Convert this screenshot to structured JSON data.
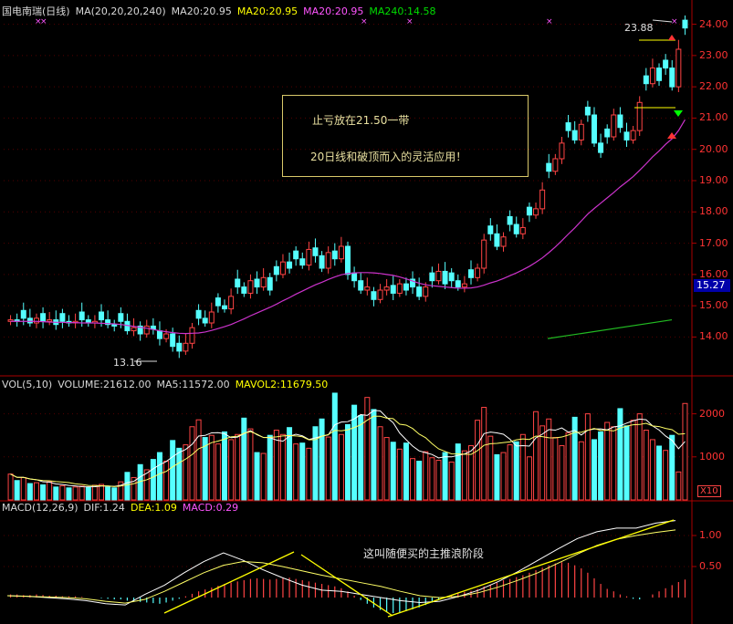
{
  "header": {
    "stock": "国电南瑞(日线)",
    "ma_params": "MA(20,20,20,240)",
    "ma20a": "MA20:20.95",
    "ma20b": "MA20:20.95",
    "ma20c": "MA20:20.95",
    "ma240": "MA240:14.58"
  },
  "vol_header": {
    "params": "VOL(5,10)",
    "volume": "VOLUME:21612.00",
    "ma5": "MA5:11572.00",
    "mavol2": "MAVOL2:11679.50"
  },
  "macd_header": {
    "params": "MACD(12,26,9)",
    "dif": "DIF:1.24",
    "dea": "DEA:1.09",
    "macd": "MACD:0.29"
  },
  "annotations": {
    "note_line1": "止亏放在21.50一带",
    "note_line2": "20日线和破顶而入的灵活应用！",
    "macd_note": "这叫随便买的主推浪阶段",
    "low_label": "13.16",
    "high_label": "23.88",
    "last_price": "15.27",
    "vol_unit": "X10"
  },
  "colors": {
    "up": "#ff4444",
    "down": "#55ffff",
    "ma20": "#cc33cc",
    "ma240": "#22bb22",
    "vol_ma5": "#ffffff",
    "vol_ma10": "#ffff66",
    "axis": "#aa0000"
  },
  "chart_data": {
    "type": "candlestick",
    "price_axis": {
      "min": 13.5,
      "max": 24.0,
      "ticks": [
        "24.00",
        "23.00",
        "22.00",
        "21.00",
        "20.00",
        "19.00",
        "18.00",
        "17.00",
        "16.00",
        "15.00",
        "14.00"
      ]
    },
    "volume_axis": {
      "max": 2400,
      "ticks": [
        "2000",
        "1000"
      ]
    },
    "macd_axis": {
      "ticks": [
        "1.00",
        "0.50"
      ]
    },
    "close": [
      14.55,
      14.5,
      14.6,
      14.45,
      14.6,
      14.5,
      14.55,
      14.4,
      14.5,
      14.45,
      14.5,
      14.55,
      14.45,
      14.5,
      14.55,
      14.4,
      14.35,
      14.5,
      14.2,
      14.3,
      14.1,
      14.35,
      14.25,
      13.95,
      14.1,
      13.7,
      13.55,
      13.8,
      14.3,
      14.6,
      14.45,
      14.8,
      15.0,
      14.9,
      15.3,
      15.6,
      15.4,
      15.8,
      15.6,
      15.9,
      15.5,
      16.0,
      16.4,
      16.2,
      16.5,
      16.3,
      16.8,
      16.6,
      16.2,
      16.7,
      16.5,
      16.9,
      16.0,
      15.8,
      15.5,
      15.6,
      15.2,
      15.5,
      15.6,
      15.4,
      15.7,
      15.5,
      15.6,
      15.3,
      15.6,
      15.8,
      16.1,
      15.7,
      15.8,
      15.6,
      15.7,
      15.9,
      16.2,
      17.1,
      17.3,
      16.9,
      17.2,
      17.6,
      17.3,
      17.5,
      17.9,
      18.1,
      18.7,
      19.3,
      19.7,
      20.2,
      20.6,
      20.3,
      20.8,
      21.1,
      20.2,
      19.9,
      20.4,
      21.1,
      20.7,
      20.3,
      20.6,
      21.5,
      22.1,
      22.6,
      22.2,
      22.6,
      22.0,
      23.2,
      23.88
    ],
    "ma20": [
      14.5,
      14.5,
      14.5,
      14.5,
      14.5,
      14.49,
      14.48,
      14.47,
      14.47,
      14.46,
      14.46,
      14.45,
      14.45,
      14.45,
      14.44,
      14.43,
      14.42,
      14.4,
      14.37,
      14.34,
      14.31,
      14.28,
      14.24,
      14.2,
      14.17,
      14.14,
      14.12,
      14.11,
      14.12,
      14.13,
      14.16,
      14.21,
      14.27,
      14.33,
      14.4,
      14.49,
      14.58,
      14.68,
      14.77,
      14.86,
      14.95,
      15.05,
      15.16,
      15.26,
      15.37,
      15.47,
      15.57,
      15.67,
      15.75,
      15.84,
      15.92,
      15.99,
      16.03,
      16.05,
      16.06,
      16.06,
      16.05,
      16.03,
      16.0,
      15.97,
      15.92,
      15.86,
      15.79,
      15.72,
      15.67,
      15.64,
      15.62,
      15.6,
      15.58,
      15.56,
      15.56,
      15.57,
      15.6,
      15.66,
      15.73,
      15.79,
      15.87,
      15.96,
      16.05,
      16.15,
      16.26,
      16.39,
      16.53,
      16.7,
      16.88,
      17.08,
      17.29,
      17.49,
      17.71,
      17.93,
      18.11,
      18.28,
      18.45,
      18.62,
      18.8,
      18.96,
      19.13,
      19.33,
      19.54,
      19.76,
      19.95,
      20.16,
      20.34,
      20.6,
      20.95
    ],
    "ma240": {
      "start": 13.95,
      "end": 14.58
    },
    "volume": [
      600,
      450,
      520,
      380,
      400,
      350,
      420,
      300,
      330,
      280,
      300,
      320,
      290,
      340,
      360,
      300,
      280,
      420,
      640,
      520,
      820,
      700,
      940,
      1100,
      900,
      1380,
      1200,
      1280,
      1700,
      1860,
      1450,
      1500,
      1300,
      1580,
      1400,
      1520,
      1900,
      1650,
      1100,
      1080,
      1500,
      1620,
      1520,
      1680,
      1300,
      1320,
      1200,
      1700,
      1880,
      1460,
      2480,
      1520,
      1750,
      2200,
      1960,
      2380,
      2100,
      1700,
      1450,
      1340,
      1180,
      1320,
      960,
      900,
      1120,
      980,
      920,
      1100,
      880,
      1300,
      1140,
      1260,
      1850,
      2150,
      1480,
      1050,
      1100,
      1280,
      1350,
      1520,
      1000,
      2050,
      1720,
      1880,
      1450,
      1260,
      1560,
      1920,
      1350,
      2000,
      1400,
      1580,
      1800,
      1700,
      2120,
      1720,
      1850,
      2000,
      1620,
      1400,
      1250,
      1150,
      1500,
      650,
      2240
    ],
    "macd_hist": [
      0.05,
      0.05,
      0.04,
      0.04,
      0.05,
      0.04,
      0.03,
      0.03,
      0.02,
      0.02,
      0.02,
      0.01,
      0.0,
      0.0,
      -0.01,
      -0.02,
      -0.03,
      -0.03,
      -0.05,
      -0.06,
      -0.07,
      -0.08,
      -0.09,
      -0.1,
      -0.08,
      -0.05,
      -0.02,
      0.02,
      0.06,
      0.1,
      0.13,
      0.16,
      0.19,
      0.22,
      0.24,
      0.26,
      0.28,
      0.3,
      0.31,
      0.3,
      0.29,
      0.3,
      0.31,
      0.32,
      0.3,
      0.28,
      0.26,
      0.24,
      0.22,
      0.2,
      0.18,
      0.15,
      0.1,
      0.03,
      -0.04,
      -0.1,
      -0.16,
      -0.2,
      -0.23,
      -0.25,
      -0.24,
      -0.22,
      -0.19,
      -0.16,
      -0.12,
      -0.08,
      -0.04,
      0.0,
      0.04,
      0.07,
      0.09,
      0.11,
      0.14,
      0.18,
      0.21,
      0.24,
      0.28,
      0.3,
      0.33,
      0.36,
      0.4,
      0.44,
      0.48,
      0.52,
      0.55,
      0.57,
      0.56,
      0.52,
      0.47,
      0.4,
      0.31,
      0.22,
      0.14,
      0.1,
      0.05,
      0.02,
      -0.02,
      -0.03,
      0.0,
      0.05,
      0.1,
      0.15,
      0.2,
      0.25,
      0.29
    ],
    "dif_points": [
      0.03,
      0.02,
      0.0,
      -0.02,
      -0.05,
      -0.1,
      -0.12,
      0.05,
      0.2,
      0.4,
      0.58,
      0.72,
      0.6,
      0.45,
      0.32,
      0.2,
      0.12,
      0.1,
      0.05,
      0.0,
      -0.05,
      -0.08,
      -0.06,
      0.02,
      0.12,
      0.26,
      0.42,
      0.6,
      0.78,
      0.95,
      1.06,
      1.12,
      1.12,
      1.2,
      1.24
    ],
    "dea_points": [
      0.03,
      0.02,
      0.01,
      0.0,
      -0.02,
      -0.06,
      -0.09,
      -0.03,
      0.1,
      0.25,
      0.4,
      0.52,
      0.58,
      0.56,
      0.5,
      0.43,
      0.36,
      0.3,
      0.24,
      0.18,
      0.1,
      0.03,
      0.0,
      0.02,
      0.08,
      0.17,
      0.28,
      0.4,
      0.55,
      0.7,
      0.84,
      0.94,
      1.0,
      1.05,
      1.09
    ]
  }
}
